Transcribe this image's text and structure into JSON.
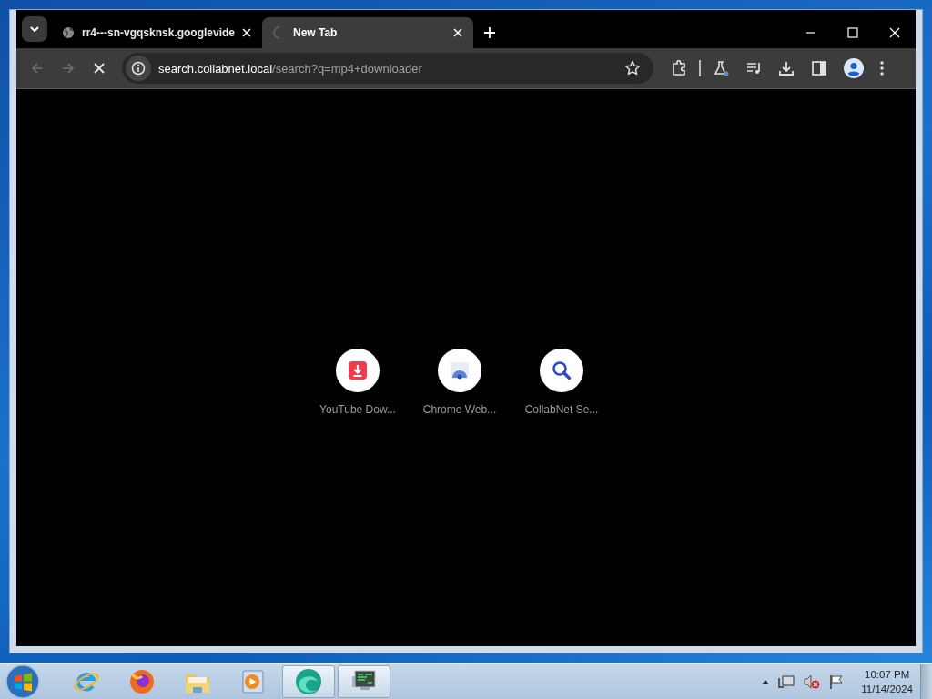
{
  "tabs": [
    {
      "title": "rr4---sn-vgqsknsk.googlevide",
      "selected": false,
      "kind": "globe"
    },
    {
      "title": "New Tab",
      "selected": true,
      "kind": "loading"
    }
  ],
  "toolbar": {
    "url_host": "search.collabnet.local",
    "url_path": "/search?q=mp4+downloader",
    "loading": true
  },
  "shortcuts": [
    {
      "label": "YouTube Dow...",
      "kind": "download"
    },
    {
      "label": "Chrome Web...",
      "kind": "webstore"
    },
    {
      "label": "CollabNet Se...",
      "kind": "search"
    }
  ],
  "taskbar": {
    "apps": [
      {
        "kind": "ie",
        "active": false
      },
      {
        "kind": "firefox",
        "active": false
      },
      {
        "kind": "folder",
        "active": false
      },
      {
        "kind": "media",
        "active": false
      },
      {
        "kind": "edge",
        "active": true
      },
      {
        "kind": "monitor",
        "active": true
      }
    ]
  },
  "clock": {
    "time": "10:07 PM",
    "date": "11/14/2024"
  }
}
